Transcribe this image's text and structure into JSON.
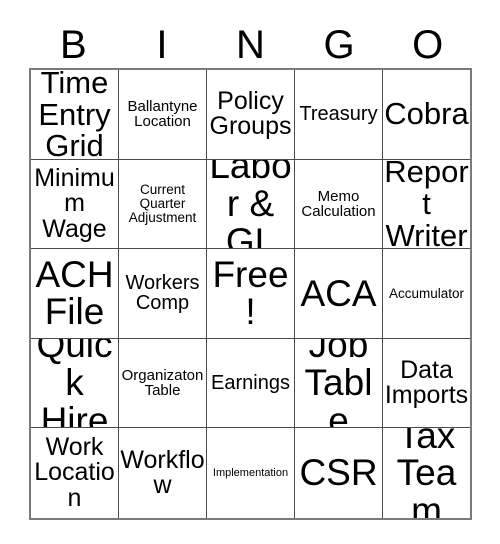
{
  "header": {
    "letters": [
      "B",
      "I",
      "N",
      "G",
      "O"
    ]
  },
  "grid": {
    "rows": 5,
    "columns": 5,
    "cells": [
      [
        {
          "text": "Time Entry Grid",
          "size": "fs-xl"
        },
        {
          "text": "Ballantyne Location",
          "size": "fs-s"
        },
        {
          "text": "Policy Groups",
          "size": "fs-l"
        },
        {
          "text": "Treasury",
          "size": "fs-m"
        },
        {
          "text": "Cobra",
          "size": "fs-xl"
        }
      ],
      [
        {
          "text": "Minimum Wage",
          "size": "fs-l"
        },
        {
          "text": "Current Quarter Adjustment",
          "size": "fs-xs"
        },
        {
          "text": "Labor & GL",
          "size": "fs-xxl"
        },
        {
          "text": "Memo Calculation",
          "size": "fs-s"
        },
        {
          "text": "Report Writer",
          "size": "fs-xl"
        }
      ],
      [
        {
          "text": "ACH File",
          "size": "fs-xxl"
        },
        {
          "text": "Workers Comp",
          "size": "fs-m"
        },
        {
          "text": "Free!",
          "size": "fs-xxl"
        },
        {
          "text": "ACA",
          "size": "fs-xxl"
        },
        {
          "text": "Accumulator",
          "size": "fs-xs"
        }
      ],
      [
        {
          "text": "Quick Hire",
          "size": "fs-xxl"
        },
        {
          "text": "Organizaton Table",
          "size": "fs-s"
        },
        {
          "text": "Earnings",
          "size": "fs-m"
        },
        {
          "text": "Job Table",
          "size": "fs-xxl"
        },
        {
          "text": "Data Imports",
          "size": "fs-l"
        }
      ],
      [
        {
          "text": "Work Location",
          "size": "fs-l"
        },
        {
          "text": "Workflow",
          "size": "fs-l"
        },
        {
          "text": "Implementation",
          "size": "fs-xxs"
        },
        {
          "text": "CSR",
          "size": "fs-xxl"
        },
        {
          "text": "Tax Team",
          "size": "fs-xxl"
        }
      ]
    ]
  },
  "colors": {
    "background": "#ffffff",
    "text": "#000000",
    "grid_line": "#4a4a4a",
    "grid_border": "#7a7a7a"
  }
}
